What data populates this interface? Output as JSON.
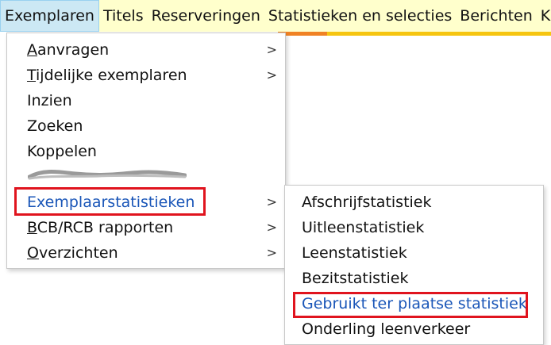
{
  "menubar": {
    "items": [
      {
        "label": "Exemplaren",
        "active": true
      },
      {
        "label": "Titels"
      },
      {
        "label": "Reserveringen"
      },
      {
        "label": "Statistieken en selecties"
      },
      {
        "label": "Berichten"
      },
      {
        "label": "K"
      }
    ]
  },
  "main_menu": {
    "aanvragen": {
      "mnemonic": "A",
      "rest": "anvragen"
    },
    "tijdelijke": {
      "mnemonic": "T",
      "rest": "ijdelijke exemplaren"
    },
    "inzien": {
      "label": "Inzien"
    },
    "zoeken": {
      "label": "Zoeken"
    },
    "koppelen": {
      "label": "Koppelen"
    },
    "exemplaarstatistieken": {
      "label": "Exemplaarstatistieken"
    },
    "bcb": {
      "mnemonic": "B",
      "rest": "CB/RCB rapporten"
    },
    "overzichten": {
      "mnemonic": "O",
      "rest": "verzichten"
    },
    "submenu_arrow": ">"
  },
  "submenu": {
    "items": [
      {
        "label": "Afschrijfstatistiek"
      },
      {
        "label": "Uitleenstatistiek"
      },
      {
        "label": "Leenstatistiek"
      },
      {
        "label": "Bezitstatistiek"
      },
      {
        "label": "Gebruikt ter plaatse statistiek"
      },
      {
        "label": "Onderling leenverkeer"
      }
    ]
  },
  "colors": {
    "menubar_bg": "#ffffcc",
    "active_bg": "#cce8f4",
    "highlight_border": "#e0141e",
    "selected_text": "#1a56b8",
    "accent_yellow": "#f6c510",
    "accent_orange": "#f08224"
  }
}
